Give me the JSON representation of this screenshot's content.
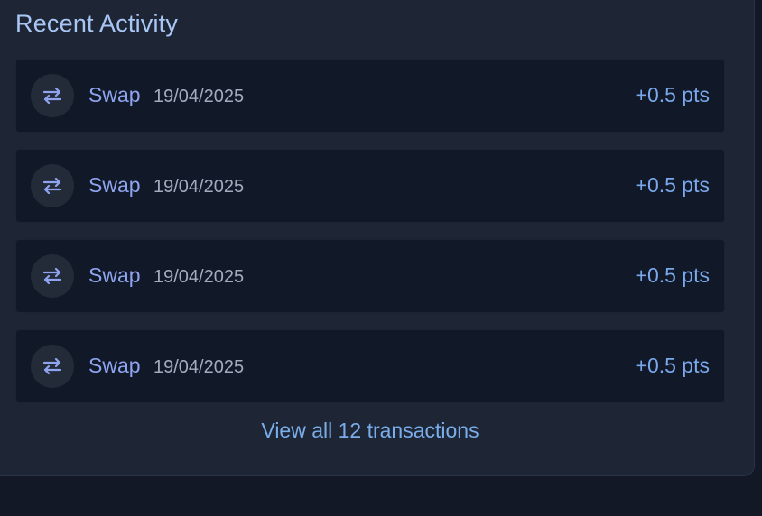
{
  "section": {
    "title": "Recent Activity"
  },
  "transactions": [
    {
      "type": "Swap",
      "date": "19/04/2025",
      "points": "+0.5 pts",
      "icon": "swap-arrows-icon"
    },
    {
      "type": "Swap",
      "date": "19/04/2025",
      "points": "+0.5 pts",
      "icon": "swap-arrows-icon"
    },
    {
      "type": "Swap",
      "date": "19/04/2025",
      "points": "+0.5 pts",
      "icon": "swap-arrows-icon"
    },
    {
      "type": "Swap",
      "date": "19/04/2025",
      "points": "+0.5 pts",
      "icon": "swap-arrows-icon"
    }
  ],
  "footer": {
    "view_all_label": "View all 12 transactions"
  },
  "colors": {
    "page_bg": "#121826",
    "card_bg": "#1e2535",
    "row_bg": "#111827",
    "title": "#a9c7f5",
    "type": "#8ea4ee",
    "date": "#a2acbf",
    "points": "#7aa8ec",
    "link": "#7aaeea"
  }
}
